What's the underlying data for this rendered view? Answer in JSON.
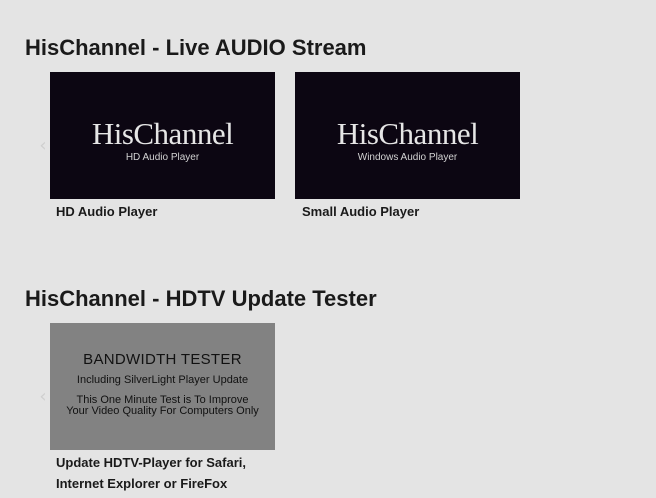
{
  "audio_section": {
    "title": "HisChannel - Live AUDIO Stream",
    "prev_arrow": "‹",
    "items": [
      {
        "thumbnail_brand": "HisChannel",
        "thumbnail_subtitle": "HD Audio Player",
        "caption": "HD Audio Player"
      },
      {
        "thumbnail_brand": "HisChannel",
        "thumbnail_subtitle": "Windows Audio Player",
        "caption": "Small Audio Player"
      }
    ]
  },
  "hdtv_section": {
    "title": "HisChannel - HDTV Update Tester",
    "prev_arrow": "‹",
    "items": [
      {
        "thumbnail_heading": "BANDWIDTH TESTER",
        "thumbnail_line1": "Including SilverLight Player Update",
        "thumbnail_line2": "This One Minute Test is To Improve",
        "thumbnail_line3": "Your Video Quality For Computers Only",
        "caption_line1": "Update HDTV-Player for Safari,",
        "caption_line2": "Internet Explorer or FireFox"
      }
    ]
  },
  "colors": {
    "page_background": "#e4e4e4",
    "dark_thumbnail": "#0c0612",
    "gray_thumbnail": "#828282",
    "text": "#1a1a1a"
  },
  "icons": {
    "carousel_prev": "chevron-left-icon"
  }
}
